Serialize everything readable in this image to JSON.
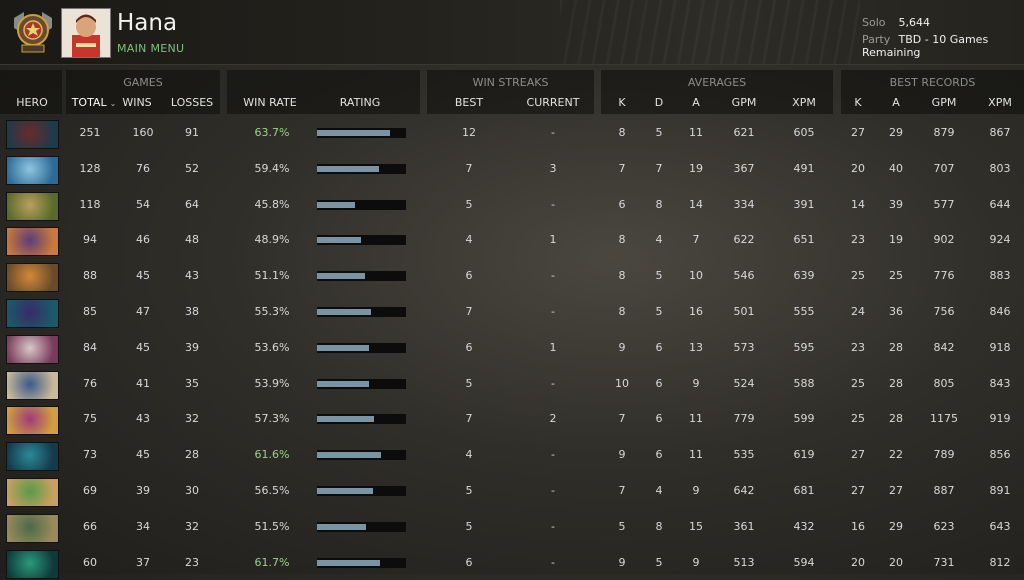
{
  "player": {
    "name": "Hana",
    "main_menu_label": "MAIN MENU",
    "solo_label": "Solo",
    "solo_value": "5,644",
    "party_label": "Party",
    "party_value": "TBD - 10 Games Remaining"
  },
  "groups": {
    "games": "GAMES",
    "win_streaks": "WIN STREAKS",
    "averages": "AVERAGES",
    "best_records": "BEST RECORDS"
  },
  "columns": {
    "hero": "HERO",
    "total": "TOTAL",
    "wins": "WINS",
    "losses": "LOSSES",
    "win_rate": "WIN RATE",
    "rating": "RATING",
    "best": "BEST",
    "current": "CURRENT",
    "avg_k": "K",
    "avg_d": "D",
    "avg_a": "A",
    "avg_gpm": "GPM",
    "avg_xpm": "XPM",
    "rec_k": "K",
    "rec_a": "A",
    "rec_gpm": "GPM",
    "rec_xpm": "XPM"
  },
  "colors": {
    "win_rate_highlight": "#9ad28a",
    "rating_fill": "#7a94a3",
    "menu_green": "#7fc07a"
  },
  "rows": [
    {
      "hero_icon": "hero-portrait-red-hooded",
      "total": "251",
      "wins": "160",
      "losses": "91",
      "win_rate": "63.7%",
      "rating": 0.82,
      "best": "12",
      "current": "-",
      "k": "8",
      "d": "5",
      "a": "11",
      "gpm": "621",
      "xpm": "605",
      "rk": "27",
      "ra": "29",
      "rgpm": "879",
      "rxpm": "867",
      "c1": "#6b2a2a",
      "c2": "#1d3b4a"
    },
    {
      "hero_icon": "hero-portrait-ice-blue",
      "total": "128",
      "wins": "76",
      "losses": "52",
      "win_rate": "59.4%",
      "rating": 0.7,
      "best": "7",
      "current": "3",
      "k": "7",
      "d": "7",
      "a": "19",
      "gpm": "367",
      "xpm": "491",
      "rk": "20",
      "ra": "40",
      "rgpm": "707",
      "rxpm": "803",
      "c1": "#8fc6e0",
      "c2": "#2d6a96"
    },
    {
      "hero_icon": "hero-portrait-ogre-brown",
      "total": "118",
      "wins": "54",
      "losses": "64",
      "win_rate": "45.8%",
      "rating": 0.43,
      "best": "5",
      "current": "-",
      "k": "6",
      "d": "8",
      "a": "14",
      "gpm": "334",
      "xpm": "391",
      "rk": "14",
      "ra": "39",
      "rgpm": "577",
      "rxpm": "644",
      "c1": "#b9a060",
      "c2": "#5a6a2a"
    },
    {
      "hero_icon": "hero-portrait-purple-mage",
      "total": "94",
      "wins": "46",
      "losses": "48",
      "win_rate": "48.9%",
      "rating": 0.49,
      "best": "4",
      "current": "1",
      "k": "8",
      "d": "4",
      "a": "7",
      "gpm": "622",
      "xpm": "651",
      "rk": "23",
      "ra": "19",
      "rgpm": "902",
      "rxpm": "924",
      "c1": "#5a3d7a",
      "c2": "#c97a3a"
    },
    {
      "hero_icon": "hero-portrait-orange-gunner",
      "total": "88",
      "wins": "45",
      "losses": "43",
      "win_rate": "51.1%",
      "rating": 0.54,
      "best": "6",
      "current": "-",
      "k": "8",
      "d": "5",
      "a": "10",
      "gpm": "546",
      "xpm": "639",
      "rk": "25",
      "ra": "25",
      "rgpm": "776",
      "rxpm": "883",
      "c1": "#d08a3a",
      "c2": "#6a4a2a"
    },
    {
      "hero_icon": "hero-portrait-violet-shadow",
      "total": "85",
      "wins": "47",
      "losses": "38",
      "win_rate": "55.3%",
      "rating": 0.61,
      "best": "7",
      "current": "-",
      "k": "8",
      "d": "5",
      "a": "16",
      "gpm": "501",
      "xpm": "555",
      "rk": "24",
      "ra": "36",
      "rgpm": "756",
      "rxpm": "846",
      "c1": "#3a2a6a",
      "c2": "#1a5a6a"
    },
    {
      "hero_icon": "hero-portrait-pale-witch",
      "total": "84",
      "wins": "45",
      "losses": "39",
      "win_rate": "53.6%",
      "rating": 0.58,
      "best": "6",
      "current": "1",
      "k": "9",
      "d": "6",
      "a": "13",
      "gpm": "573",
      "xpm": "595",
      "rk": "23",
      "ra": "28",
      "rgpm": "842",
      "rxpm": "918",
      "c1": "#d8c8c8",
      "c2": "#7a3a5a"
    },
    {
      "hero_icon": "hero-portrait-blue-sorcerer",
      "total": "76",
      "wins": "41",
      "losses": "35",
      "win_rate": "53.9%",
      "rating": 0.58,
      "best": "5",
      "current": "-",
      "k": "10",
      "d": "6",
      "a": "9",
      "gpm": "524",
      "xpm": "588",
      "rk": "25",
      "ra": "28",
      "rgpm": "805",
      "rxpm": "843",
      "c1": "#3a5a8a",
      "c2": "#c9b89a"
    },
    {
      "hero_icon": "hero-portrait-magenta-jester",
      "total": "75",
      "wins": "43",
      "losses": "32",
      "win_rate": "57.3%",
      "rating": 0.64,
      "best": "7",
      "current": "2",
      "k": "7",
      "d": "6",
      "a": "11",
      "gpm": "779",
      "xpm": "599",
      "rk": "25",
      "ra": "28",
      "rgpm": "1175",
      "rxpm": "919",
      "c1": "#a03a7a",
      "c2": "#d0a040"
    },
    {
      "hero_icon": "hero-portrait-teal-spirit",
      "total": "73",
      "wins": "45",
      "losses": "28",
      "win_rate": "61.6%",
      "rating": 0.72,
      "best": "4",
      "current": "-",
      "k": "9",
      "d": "6",
      "a": "11",
      "gpm": "535",
      "xpm": "619",
      "rk": "27",
      "ra": "22",
      "rgpm": "789",
      "rxpm": "856",
      "c1": "#2a8a9a",
      "c2": "#153a4a"
    },
    {
      "hero_icon": "hero-portrait-green-beast",
      "total": "69",
      "wins": "39",
      "losses": "30",
      "win_rate": "56.5%",
      "rating": 0.63,
      "best": "5",
      "current": "-",
      "k": "7",
      "d": "4",
      "a": "9",
      "gpm": "642",
      "xpm": "681",
      "rk": "27",
      "ra": "27",
      "rgpm": "887",
      "rxpm": "891",
      "c1": "#5a9a4a",
      "c2": "#c9a060"
    },
    {
      "hero_icon": "hero-portrait-armored-knight",
      "total": "66",
      "wins": "34",
      "losses": "32",
      "win_rate": "51.5%",
      "rating": 0.55,
      "best": "5",
      "current": "-",
      "k": "5",
      "d": "8",
      "a": "15",
      "gpm": "361",
      "xpm": "432",
      "rk": "16",
      "ra": "29",
      "rgpm": "623",
      "rxpm": "643",
      "c1": "#4a6a4a",
      "c2": "#9a8a5a"
    },
    {
      "hero_icon": "hero-portrait-emerald-phantom",
      "total": "60",
      "wins": "37",
      "losses": "23",
      "win_rate": "61.7%",
      "rating": 0.71,
      "best": "6",
      "current": "-",
      "k": "9",
      "d": "5",
      "a": "9",
      "gpm": "513",
      "xpm": "594",
      "rk": "20",
      "ra": "20",
      "rgpm": "731",
      "rxpm": "812",
      "c1": "#2a9a7a",
      "c2": "#0e3a3a"
    }
  ]
}
